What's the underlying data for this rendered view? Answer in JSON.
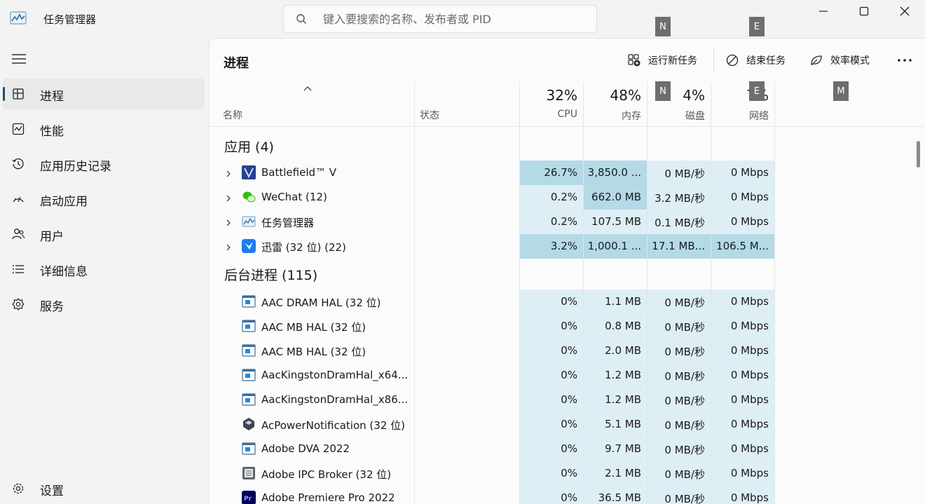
{
  "window": {
    "title": "任务管理器",
    "search_placeholder": "键入要搜索的名称、发布者或 PID",
    "search_value": ""
  },
  "sidebar": {
    "items": [
      {
        "label": "进程",
        "icon": "processes-icon",
        "active": true
      },
      {
        "label": "性能",
        "icon": "performance-icon"
      },
      {
        "label": "应用历史记录",
        "icon": "history-icon"
      },
      {
        "label": "启动应用",
        "icon": "startup-icon"
      },
      {
        "label": "用户",
        "icon": "users-icon"
      },
      {
        "label": "详细信息",
        "icon": "details-icon"
      },
      {
        "label": "服务",
        "icon": "services-icon"
      }
    ],
    "settings_label": "设置"
  },
  "main": {
    "page_title": "进程",
    "toolbar": {
      "run_new_task": "运行新任务",
      "end_task": "结束任务",
      "efficiency_mode": "效率模式",
      "more": "···"
    },
    "key_tips": [
      "N",
      "E",
      "N",
      "E",
      "M"
    ],
    "columns": {
      "name": "名称",
      "status": "状态",
      "cpu": {
        "pct": "32%",
        "label": "CPU"
      },
      "memory": {
        "pct": "48%",
        "label": "内存"
      },
      "disk": {
        "pct": "4%",
        "label": "磁盘"
      },
      "network": {
        "pct": "7%",
        "label": "网络"
      }
    },
    "groups": [
      {
        "label": "应用 (4)",
        "rows": [
          {
            "name": "Battlefield™ V",
            "cpu": "26.7%",
            "mem": "3,850.0 ...",
            "disk": "0 MB/秒",
            "net": "0 Mbps",
            "icon": "battlefield-icon",
            "heat": [
              "h3",
              "h3",
              "h1",
              "h1"
            ]
          },
          {
            "name": "WeChat (12)",
            "cpu": "0.2%",
            "mem": "662.0 MB",
            "disk": "3.2 MB/秒",
            "net": "0 Mbps",
            "icon": "wechat-icon",
            "heat": [
              "h1",
              "h3",
              "h1",
              "h1"
            ]
          },
          {
            "name": "任务管理器",
            "cpu": "0.2%",
            "mem": "107.5 MB",
            "disk": "0.1 MB/秒",
            "net": "0 Mbps",
            "icon": "task-manager-icon",
            "heat": [
              "h1",
              "h1",
              "h1",
              "h1"
            ]
          },
          {
            "name": "迅雷 (32 位) (22)",
            "cpu": "3.2%",
            "mem": "1,000.1 ...",
            "disk": "17.1 MB...",
            "net": "106.5 M...",
            "icon": "xunlei-icon",
            "heat": [
              "h3",
              "h3",
              "h3",
              "h3"
            ]
          }
        ]
      },
      {
        "label": "后台进程 (115)",
        "rows": [
          {
            "name": "AAC DRAM HAL (32 位)",
            "cpu": "0%",
            "mem": "1.1 MB",
            "disk": "0 MB/秒",
            "net": "0 Mbps",
            "icon": "service-app-icon"
          },
          {
            "name": "AAC MB HAL (32 位)",
            "cpu": "0%",
            "mem": "0.8 MB",
            "disk": "0 MB/秒",
            "net": "0 Mbps",
            "icon": "service-app-icon"
          },
          {
            "name": "AAC MB HAL (32 位)",
            "cpu": "0%",
            "mem": "2.0 MB",
            "disk": "0 MB/秒",
            "net": "0 Mbps",
            "icon": "service-app-icon"
          },
          {
            "name": "AacKingstonDramHal_x64....",
            "cpu": "0%",
            "mem": "1.2 MB",
            "disk": "0 MB/秒",
            "net": "0 Mbps",
            "icon": "service-app-icon"
          },
          {
            "name": "AacKingstonDramHal_x86....",
            "cpu": "0%",
            "mem": "1.2 MB",
            "disk": "0 MB/秒",
            "net": "0 Mbps",
            "icon": "service-app-icon"
          },
          {
            "name": "AcPowerNotification (32 位)",
            "cpu": "0%",
            "mem": "5.1 MB",
            "disk": "0 MB/秒",
            "net": "0 Mbps",
            "icon": "power-notification-icon"
          },
          {
            "name": "Adobe DVA 2022",
            "cpu": "0%",
            "mem": "9.7 MB",
            "disk": "0 MB/秒",
            "net": "0 Mbps",
            "icon": "service-app-icon"
          },
          {
            "name": "Adobe IPC Broker (32 位)",
            "cpu": "0%",
            "mem": "2.1 MB",
            "disk": "0 MB/秒",
            "net": "0 Mbps",
            "icon": "broker-icon"
          },
          {
            "name": "Adobe Premiere Pro 2022",
            "cpu": "0%",
            "mem": "36.5 MB",
            "disk": "0 MB/秒",
            "net": "0 Mbps",
            "icon": "premiere-icon"
          }
        ]
      }
    ]
  },
  "colors": {
    "accent": "#1f4f6b",
    "heat_low": "#deeef5",
    "heat_mid": "#c7e3ee",
    "heat_high": "#b4d9e7"
  }
}
